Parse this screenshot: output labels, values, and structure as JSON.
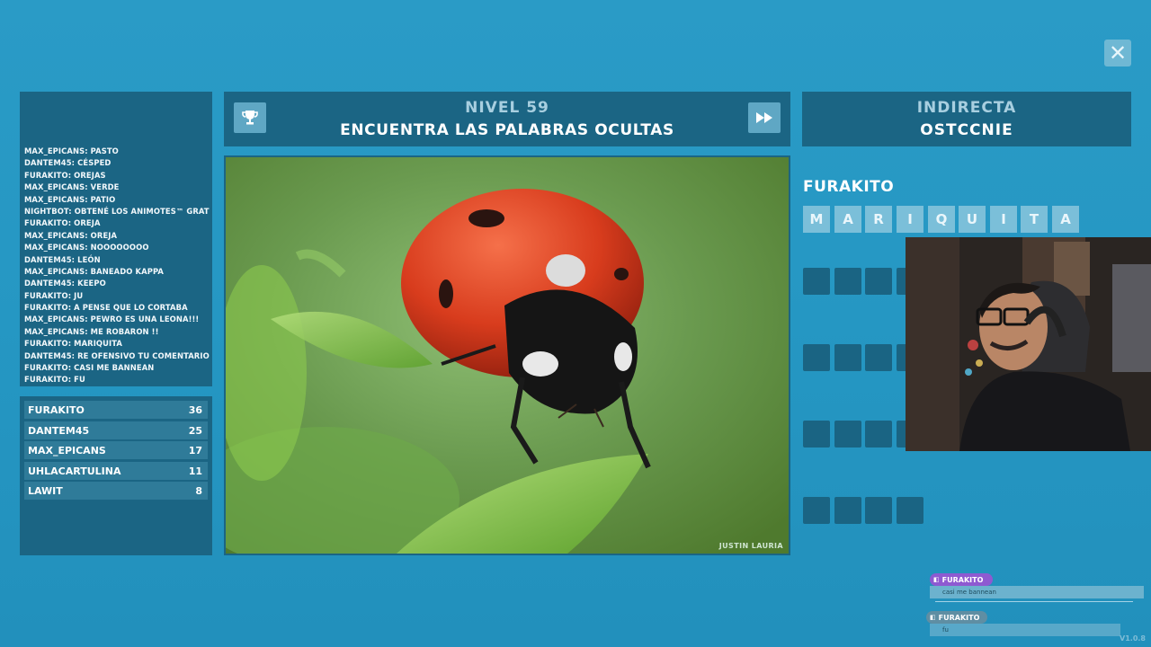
{
  "chat": {
    "messages": [
      "MAX_EPICANS: PASTO",
      "DANTEM45: CÉSPED",
      "FURAKITO: OREJAS",
      "MAX_EPICANS: VERDE",
      "MAX_EPICANS: PATIO",
      "NIGHTBOT: OBTENÉ LOS ANIMOTES™ GRATIS",
      "FURAKITO: OREJA",
      "MAX_EPICANS: OREJA",
      "MAX_EPICANS: NOOOOOOOO",
      "DANTEM45: LEÓN",
      "MAX_EPICANS: BANEADO KAPPA",
      "DANTEM45: KEEPO",
      "FURAKITO: JU",
      "FURAKITO: A PENSE QUE LO CORTABA",
      "MAX_EPICANS: PEWRO ES UNA LEONA!!!",
      "MAX_EPICANS: ME ROBARON !!",
      "FURAKITO: MARIQUITA",
      "DANTEM45: RE OFENSIVO TU COMENTARIO",
      "FURAKITO: CASI ME BANNEAN",
      "FURAKITO: FU"
    ]
  },
  "leaderboard": [
    {
      "name": "FURAKITO",
      "score": "36"
    },
    {
      "name": "DANTEM45",
      "score": "25"
    },
    {
      "name": "MAX_EPICANS",
      "score": "17"
    },
    {
      "name": "UHLACARTULINA",
      "score": "11"
    },
    {
      "name": "LAWIT",
      "score": "8"
    }
  ],
  "header": {
    "level": "NIVEL 59",
    "subtitle": "ENCUENTRA LAS PALABRAS OCULTAS"
  },
  "image": {
    "credit": "JUSTIN LAURIA"
  },
  "hint": {
    "label": "INDIRECTA",
    "word": "OSTCCNIE"
  },
  "solved": {
    "player": "FURAKITO",
    "letters": [
      "M",
      "A",
      "R",
      "I",
      "Q",
      "U",
      "I",
      "T",
      "A"
    ]
  },
  "notifications": [
    {
      "user": "FURAKITO",
      "text": "casi me bannean"
    },
    {
      "user": "FURAKITO",
      "text": "fu"
    }
  ],
  "version": "V1.0.8",
  "icons": {
    "close": "close-icon",
    "trophy": "trophy-icon",
    "skip": "fast-forward-icon"
  },
  "colors": {
    "background": "#2597c3",
    "panel": "#1b6584",
    "tile_letter": "#7bbfd9",
    "tile_empty": "#1a6483",
    "notif_tag": "#8e5ad1"
  }
}
